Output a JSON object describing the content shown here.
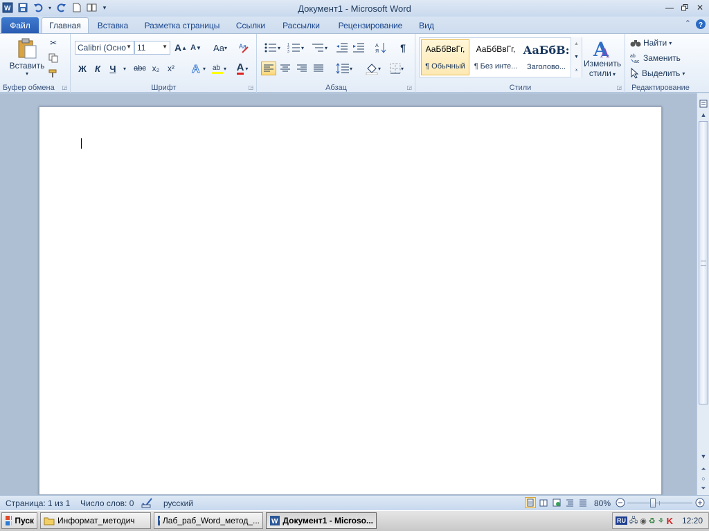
{
  "window": {
    "title": "Документ1  -  Microsoft Word",
    "qat_icons": [
      "word-app-icon",
      "save-icon",
      "undo-icon",
      "redo-icon",
      "new-document-icon",
      "open-icon",
      "customize-qat-icon"
    ]
  },
  "tabs": {
    "file": "Файл",
    "home": "Главная",
    "insert": "Вставка",
    "page_layout": "Разметка страницы",
    "references": "Ссылки",
    "mailings": "Рассылки",
    "review": "Рецензирование",
    "view": "Вид"
  },
  "ribbon": {
    "clipboard": {
      "label": "Буфер обмена",
      "paste": "Вставить"
    },
    "font": {
      "label": "Шрифт",
      "font_name": "Calibri (Осно",
      "font_size": "11",
      "grow": "A",
      "shrink": "A",
      "change_case": "Aa",
      "bold": "Ж",
      "italic": "К",
      "underline": "Ч",
      "strike": "abc",
      "subscript": "x₂",
      "superscript": "x²",
      "font_color_letter": "A"
    },
    "paragraph": {
      "label": "Абзац",
      "pilcrow": "¶"
    },
    "styles": {
      "label": "Стили",
      "items": [
        {
          "preview": "АаБбВвГг,",
          "name": "¶ Обычный"
        },
        {
          "preview": "АаБбВвГг,",
          "name": "¶ Без инте..."
        },
        {
          "preview": "АаБбВ:",
          "name": "Заголово..."
        }
      ],
      "change_styles_line1": "Изменить",
      "change_styles_line2": "стили"
    },
    "editing": {
      "label": "Редактирование",
      "find": "Найти",
      "replace": "Заменить",
      "select": "Выделить"
    }
  },
  "status": {
    "page": "Страница: 1 из 1",
    "words": "Число слов: 0",
    "language": "русский",
    "zoom": "80%",
    "zoom_fraction": 0.8
  },
  "taskbar": {
    "start": "Пуск",
    "items": [
      "Информат_методич",
      "Лаб_раб_Word_метод_...",
      "Документ1 - Microso..."
    ],
    "lang": "RU",
    "clock": "12:20"
  },
  "colors": {
    "file_tab": "#2a5db3",
    "selected_style_border": "#e8b94a",
    "ribbon_text": "#1e395b"
  }
}
